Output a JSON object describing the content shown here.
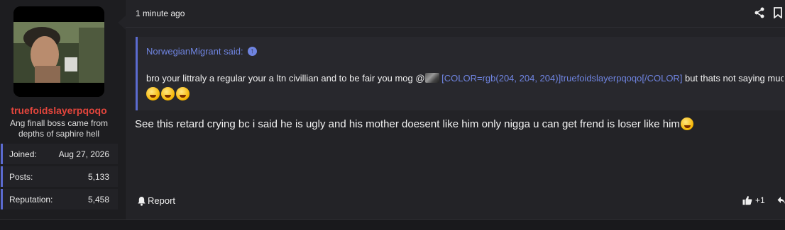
{
  "user": {
    "username": "truefoidslayerpqoqo",
    "title": "Ang finall boss came from depths of saphire hell",
    "stats": [
      {
        "label": "Joined:",
        "value": "Aug 27, 2026"
      },
      {
        "label": "Posts:",
        "value": "5,133"
      },
      {
        "label": "Reputation:",
        "value": "5,458"
      }
    ],
    "username_color": "#e2453c"
  },
  "post": {
    "time": "1 minute ago",
    "quote": {
      "author": "NorwegianMigrant said:",
      "text_before": "bro your littraly a regular your a ltn civillian and to be fair you mog @",
      "mention": "[COLOR=rgb(204, 204, 204)]truefoidslayerpqoqo[/COLOR]",
      "text_after": " but thats not saying much"
    },
    "message": "See this retard crying bc i said he is ugly and his mother doesent like him only nigga u can get frend is loser like him",
    "report_label": "Report",
    "like_count": "+1"
  },
  "icons": {
    "share": "share-icon",
    "bookmark": "bookmark-icon",
    "report": "bell-icon",
    "like": "thumbs-up-icon",
    "reply": "reply-icon"
  },
  "colors": {
    "accent": "#5b6bd0",
    "link": "#6f84e0",
    "background": "#232327"
  }
}
